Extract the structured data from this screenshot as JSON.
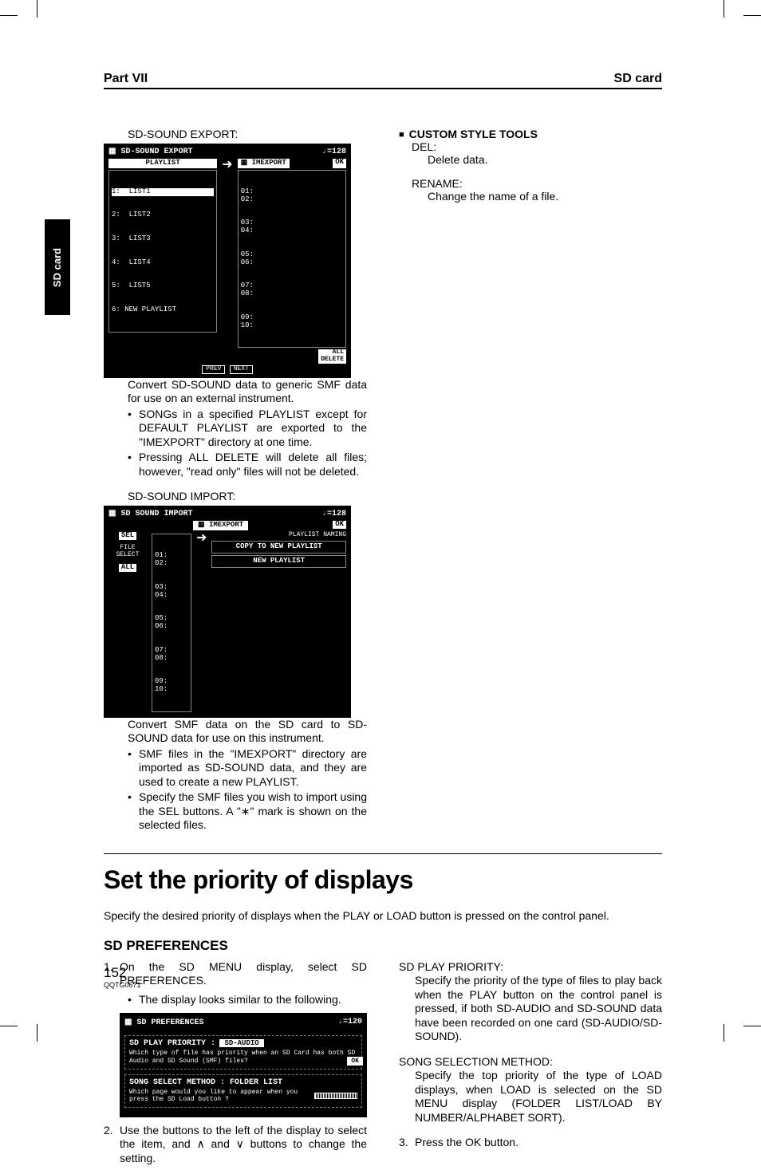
{
  "header": {
    "left": "Part VII",
    "right": "SD card"
  },
  "sideTab": "SD card",
  "left": {
    "export": {
      "label": "SD-SOUND EXPORT:",
      "ss": {
        "title": "SD-SOUND EXPORT",
        "tempo": "♩=128",
        "playlistHeader": "PLAYLIST",
        "imexportHeader": "IMEXPORT",
        "ok": "OK",
        "playlist": [
          "1:  LIST1",
          "2:  LIST2",
          "3:  LIST3",
          "4:  LIST4",
          "5:  LIST5",
          "6: NEW PLAYLIST"
        ],
        "slots": [
          "01:",
          "02:",
          "03:",
          "04:",
          "05:",
          "06:",
          "07:",
          "08:",
          "09:",
          "10:"
        ],
        "allDelete": "ALL\nDELETE",
        "prev": "PREV",
        "next": "NEXT"
      },
      "body": "Convert SD-SOUND data to generic SMF data for use on an external instrument.",
      "bullets": [
        "SONGs in a specified PLAYLIST except for DEFAULT PLAYLIST are exported to the \"IMEXPORT\" directory at one time.",
        "Pressing ALL DELETE will delete all files; however, \"read only\" files will not be deleted."
      ]
    },
    "import": {
      "label": "SD-SOUND IMPORT:",
      "ss": {
        "title": "SD SOUND IMPORT",
        "tempo": "♩=128",
        "imexportHeader": "IMEXPORT",
        "ok": "OK",
        "sel": "SEL",
        "all": "ALL",
        "fileSelect": "FILE\nSELECT",
        "slots": [
          "01:",
          "02:",
          "03:",
          "04:",
          "05:",
          "06:",
          "07:",
          "08:",
          "09:",
          "10:"
        ],
        "playlistNaming": "PLAYLIST NAMING",
        "copy": "COPY TO NEW PLAYLIST",
        "newPlaylist": "NEW PLAYLIST"
      },
      "body": "Convert SMF data on the SD card to SD-SOUND data for use on this instrument.",
      "bullets": [
        "SMF files in the \"IMEXPORT\" directory are imported as SD-SOUND data, and they are used to create a new PLAYLIST.",
        "Specify the SMF files you wish to import using the SEL buttons. A \"∗\" mark is shown on the selected files."
      ]
    }
  },
  "right": {
    "heading": "CUSTOM STYLE TOOLS",
    "items": [
      {
        "term": "DEL:",
        "desc": "Delete data."
      },
      {
        "term": "RENAME:",
        "desc": "Change the name of a file."
      }
    ]
  },
  "lower": {
    "title": "Set the priority of displays",
    "intro": "Specify the desired priority of displays when the PLAY or LOAD button is pressed on the control panel.",
    "subhead": "SD PREFERENCES",
    "leftSteps": {
      "s1": "On the SD MENU display, select SD PREFERENCES.",
      "s1bullet": "The display looks similar to the following.",
      "s2": "Use the buttons to the left of the display to select the item, and ∧ and ∨ buttons to change the setting."
    },
    "prefSS": {
      "title": "SD PREFERENCES",
      "tempo": "♩=120",
      "row1label": "SD PLAY PRIORITY :",
      "row1val": "SD-AUDIO",
      "row1desc": "Which type of file has priority when an SD Card has both SD Audio and SD Sound (SMF) files?",
      "ok": "OK",
      "row2label": "SONG SELECT METHOD : FOLDER LIST",
      "row2desc": "Which page would you like to appear when you press the SD Load button ?"
    },
    "rightDefs": [
      {
        "term": "SD PLAY PRIORITY:",
        "desc": "Specify the priority of the type of files to play back when the PLAY button on the control panel is pressed, if both SD-AUDIO and SD-SOUND data have been recorded on one card (SD-AUDIO/SD-SOUND)."
      },
      {
        "term": "SONG SELECTION METHOD:",
        "desc": "Specify the top priority of the type of LOAD displays, when LOAD is selected on the SD MENU display (FOLDER LIST/LOAD BY NUMBER/ALPHABET SORT)."
      }
    ],
    "s3": "Press the OK button."
  },
  "footer": {
    "page": "152",
    "code": "QQTG0671"
  }
}
